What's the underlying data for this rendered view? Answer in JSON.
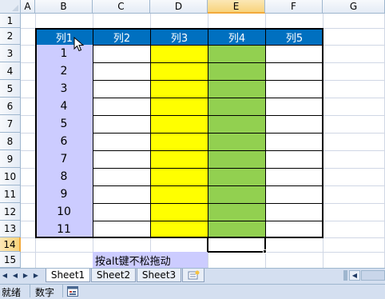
{
  "columns": [
    "A",
    "B",
    "C",
    "D",
    "E",
    "F",
    "G"
  ],
  "rows": [
    "1",
    "2",
    "3",
    "4",
    "5",
    "6",
    "7",
    "8",
    "9",
    "10",
    "11",
    "12",
    "13",
    "14",
    "15"
  ],
  "selected_column": "E",
  "selected_row": "14",
  "table": {
    "headers": [
      "列1",
      "列2",
      "列3",
      "列4",
      "列5"
    ],
    "values": [
      "1",
      "2",
      "3",
      "4",
      "5",
      "6",
      "7",
      "8",
      "9",
      "10",
      "11"
    ]
  },
  "note": "按alt键不松拖动",
  "sheets": [
    "Sheet1",
    "Sheet2",
    "Sheet3"
  ],
  "active_sheet": "Sheet1",
  "status": {
    "ready": "就绪",
    "mode": "数字"
  },
  "colors": {
    "header_fill": "#0070c0",
    "col1_fill": "#ccccff",
    "col3_fill": "#ffff00",
    "col4_fill": "#92d050"
  }
}
